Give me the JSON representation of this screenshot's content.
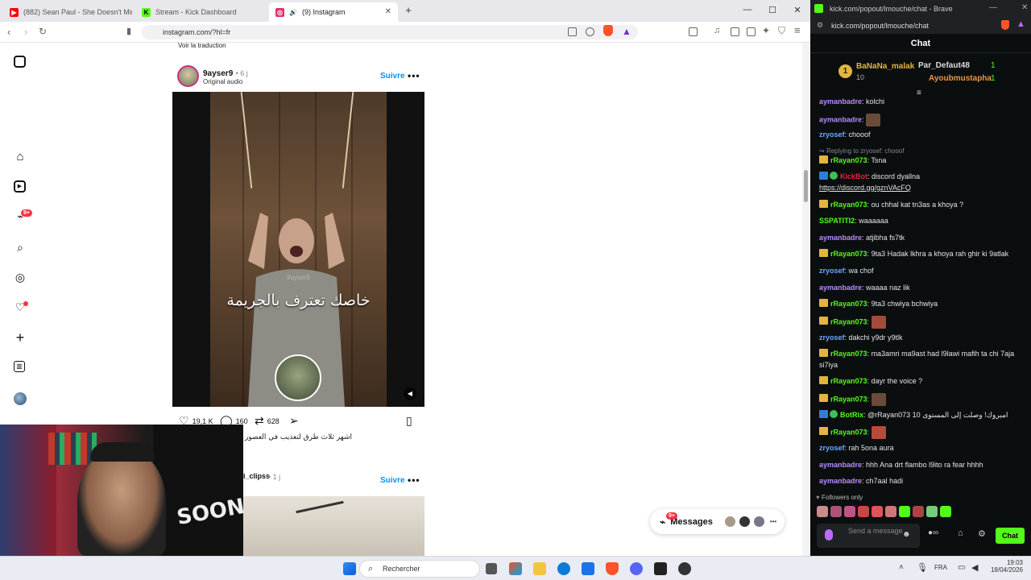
{
  "browser": {
    "tabs": [
      {
        "title": "(882) Sean Paul - She Doesn't Mind |",
        "favicon_color": "#ff0000",
        "icon": "youtube-icon"
      },
      {
        "title": "Stream - Kick Dashboard",
        "favicon_color": "#53fc18",
        "icon": "kick-icon"
      },
      {
        "title": "(9) Instagram",
        "favicon_color": "#e1306c",
        "icon": "instagram-icon",
        "active": true
      }
    ],
    "new_tab": "+",
    "url": "instagram.com/?hl=fr",
    "window_controls": {
      "minimize": "—",
      "maximize": "☐",
      "close": "✕"
    }
  },
  "instagram": {
    "translate_link": "Voir la traduction",
    "sidebar_badge": "9+",
    "post1": {
      "username": "9ayser9",
      "time": "• 6 j",
      "audio": "Original audio",
      "follow": "Suivre",
      "more": "•••",
      "video_caption": "خاصك تعترف بالجريمة",
      "watermark": "9ayser9",
      "likes": "19,1 K",
      "comments": "160",
      "reposts": "628",
      "description": "اشهر ثلاث طرق لتعذيب في العصور"
    },
    "post2": {
      "username": "i_clipss",
      "time": "• 1 j",
      "follow": "Suivre",
      "more": "•••"
    },
    "messages": {
      "label": "Messages",
      "badge": "9+"
    }
  },
  "kick": {
    "window_title": "kick.com/popout/lmouche/chat - Brave",
    "url": "kick.com/popout/lmouche/chat",
    "header": "Chat",
    "leaderboard": {
      "rank": "1",
      "top_user": "BaNaNa_malak",
      "top_count": "10",
      "second": {
        "name": "Par_Defaut48",
        "count": "1"
      },
      "third": {
        "name": "Ayoubmustapha",
        "count": "1"
      }
    },
    "messages": [
      {
        "user": "aymanbadre",
        "color": "#b88cff",
        "text": "kolchi"
      },
      {
        "user": "aymanbadre",
        "color": "#b88cff",
        "text": "",
        "emote": true
      },
      {
        "user": "zryosef",
        "color": "#6fa8ff",
        "text": "chooof"
      },
      {
        "reply": "Replying to zryosef: chooof"
      },
      {
        "user": "rRayan073",
        "color": "#53fc18",
        "text": "Tsna",
        "crown": true
      },
      {
        "user": "KickBot",
        "color": "#e1233c",
        "text": "discord dyallna",
        "bot": true
      },
      {
        "text_only": "https://discord.gg/gznVAcFQ"
      },
      {
        "user": "rRayan073",
        "color": "#53fc18",
        "text": "ou chhal kat tn3as a khoya ?",
        "crown": true
      },
      {
        "user": "SSPATITI2",
        "color": "#53fc18",
        "text": "waaaaaa"
      },
      {
        "user": "aymanbadre",
        "color": "#b88cff",
        "text": "atjibha fs7tk"
      },
      {
        "user": "rRayan073",
        "color": "#53fc18",
        "text": "9ta3 Hadak lkhra a khoya rah ghir ki 9atlak",
        "crown": true
      },
      {
        "user": "zryosef",
        "color": "#6fa8ff",
        "text": "wa chof"
      },
      {
        "user": "aymanbadre",
        "color": "#b88cff",
        "text": "waaaa naz lik"
      },
      {
        "user": "rRayan073",
        "color": "#53fc18",
        "text": "9ta3 chwiya bchwiya",
        "crown": true
      },
      {
        "user": "rRayan073",
        "color": "#53fc18",
        "text": "",
        "crown": true,
        "emote": true
      },
      {
        "user": "zryosef",
        "color": "#6fa8ff",
        "text": "dakchi y9dr y9tlk"
      },
      {
        "user": "rRayan073",
        "color": "#53fc18",
        "text": "ma3amri ma9ast had l9lawi mafih ta chi 7aja",
        "crown": true
      },
      {
        "text_only": "si7iya"
      },
      {
        "user": "rRayan073",
        "color": "#53fc18",
        "text": "dayr the voice ?",
        "crown": true
      },
      {
        "user": "rRayan073",
        "color": "#53fc18",
        "text": "",
        "crown": true,
        "emote": true
      },
      {
        "user": "BotRix",
        "color": "#53fc18",
        "text": "@rRayan073 10 امبروك! وصلت إلى المستوى",
        "bot": true
      },
      {
        "user": "rRayan073",
        "color": "#53fc18",
        "text": "",
        "crown": true,
        "emote": true
      },
      {
        "user": "zryosef",
        "color": "#6fa8ff",
        "text": "rah 5ona aura"
      },
      {
        "user": "aymanbadre",
        "color": "#b88cff",
        "text": "hhh Ana drt flambo l9ito ra fear hhhh"
      },
      {
        "user": "aymanbadre",
        "color": "#b88cff",
        "text": "ch7aal hadi"
      }
    ],
    "followers_only": "Followers only",
    "input_placeholder": "Send a message",
    "chat_button": "Chat"
  },
  "taskbar": {
    "search": "Rechercher",
    "lang": "FRA",
    "time": "19:03",
    "date": "18/04/2026"
  }
}
